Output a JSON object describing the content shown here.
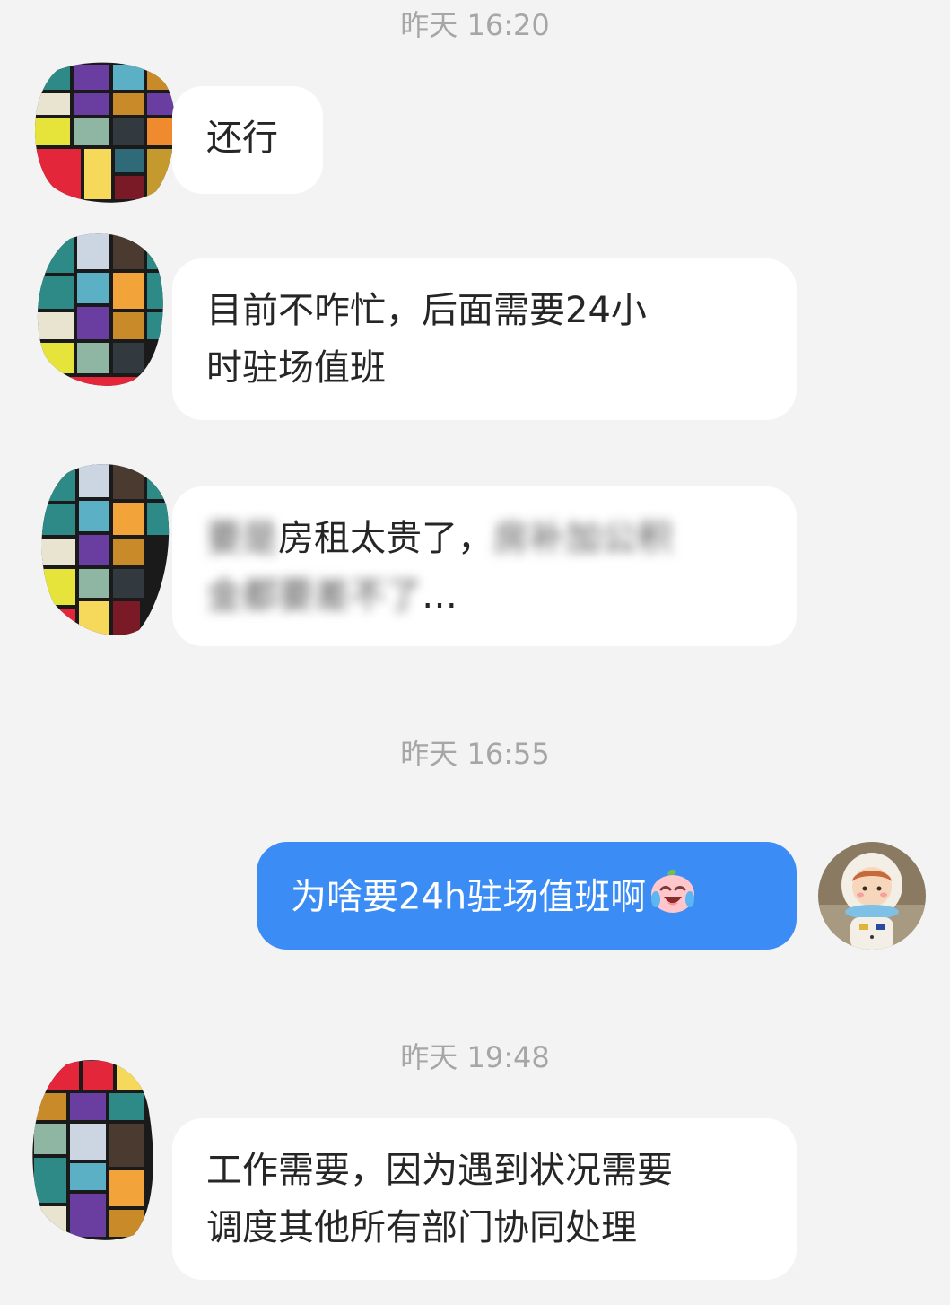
{
  "messages": [
    {
      "type": "timestamp",
      "text": "昨天 16:20"
    },
    {
      "type": "incoming",
      "text": "还行"
    },
    {
      "type": "incoming",
      "lines": [
        "目前不咋忙，后面需要24小",
        "时驻场值班"
      ]
    },
    {
      "type": "incoming",
      "lines": [
        "房租太贵了，",
        "…"
      ],
      "blurred": [
        "要是",
        "房补加公积",
        "金都要差不了"
      ]
    },
    {
      "type": "timestamp",
      "text": "昨天 16:55"
    },
    {
      "type": "outgoing",
      "text": "为啥要24h驻场值班啊",
      "emoji": "crying-laughing-peach-emoji"
    },
    {
      "type": "timestamp",
      "text": "昨天 19:48"
    },
    {
      "type": "incoming",
      "lines": [
        "工作需要，因为遇到状况需要",
        "调度其他所有部门协同处理"
      ]
    }
  ],
  "colors": {
    "background": "#f3f3f3",
    "incoming_bubble": "#ffffff",
    "outgoing_bubble": "#3b8cf5",
    "timestamp": "#a6a6a6"
  },
  "icons": {
    "contact_avatar": "mosaic-avatar-icon",
    "self_avatar": "astronaut-doll-avatar-icon"
  }
}
